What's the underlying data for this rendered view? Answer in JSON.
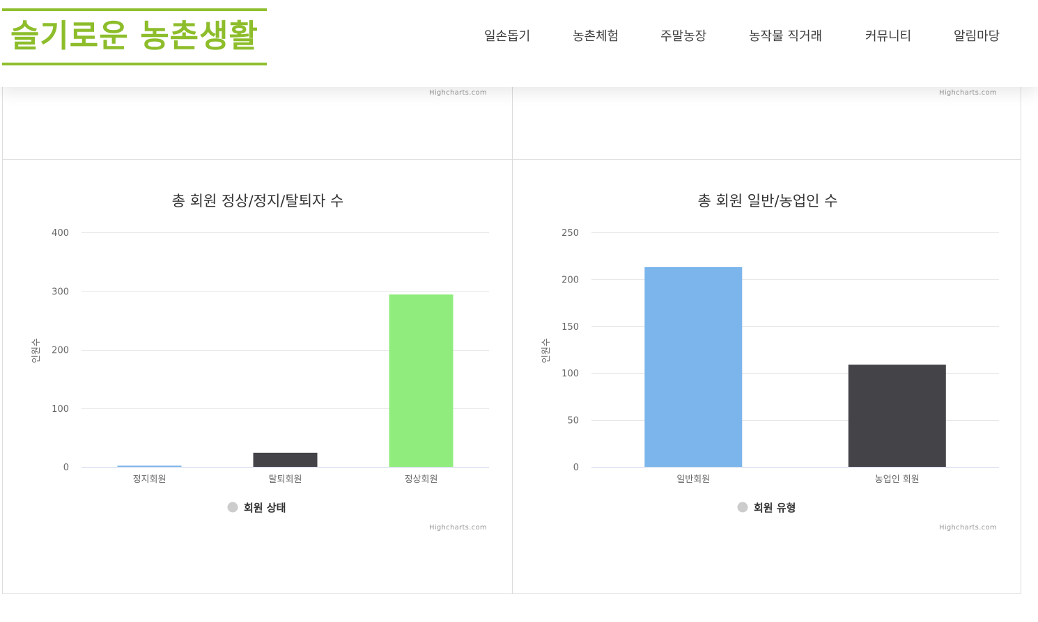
{
  "header": {
    "logo_text": "슬기로운 농촌생활",
    "nav": [
      "일손돕기",
      "농촌체험",
      "주말농장",
      "농작물 직거래",
      "커뮤니티",
      "알림마당"
    ]
  },
  "credits": {
    "top_left": "Highcharts.com",
    "top_right": "Highcharts.com",
    "bottom_left": "Highcharts.com",
    "bottom_right": "Highcharts.com"
  },
  "colors": {
    "brand": "#8dbd2b",
    "bar_blue": "#7cb5ec",
    "bar_dark": "#434348",
    "bar_green": "#90ed7d",
    "gridline": "#e6e6e6",
    "legend_symbol": "#cccccc"
  },
  "chart_data": [
    {
      "type": "bar",
      "title": "총 회원 정상/정지/탈퇴자 수",
      "ylabel": "인원수",
      "ylim": [
        0,
        400
      ],
      "yticks": [
        0,
        100,
        200,
        300,
        400
      ],
      "categories": [
        "정지회원",
        "탈퇴회원",
        "정상회원"
      ],
      "series": [
        {
          "name": "회원 상태",
          "values": [
            2,
            24,
            294
          ],
          "colors": [
            "#7cb5ec",
            "#434348",
            "#90ed7d"
          ]
        }
      ],
      "legend": "bottom-center",
      "grid": true
    },
    {
      "type": "bar",
      "title": "총 회원 일반/농업인 수",
      "ylabel": "인원수",
      "ylim": [
        0,
        250
      ],
      "yticks": [
        0,
        50,
        100,
        150,
        200,
        250
      ],
      "categories": [
        "일반회원",
        "농업인 회원"
      ],
      "series": [
        {
          "name": "회원 유형",
          "values": [
            213,
            109
          ],
          "colors": [
            "#7cb5ec",
            "#434348"
          ]
        }
      ],
      "legend": "bottom-center",
      "grid": true
    }
  ]
}
